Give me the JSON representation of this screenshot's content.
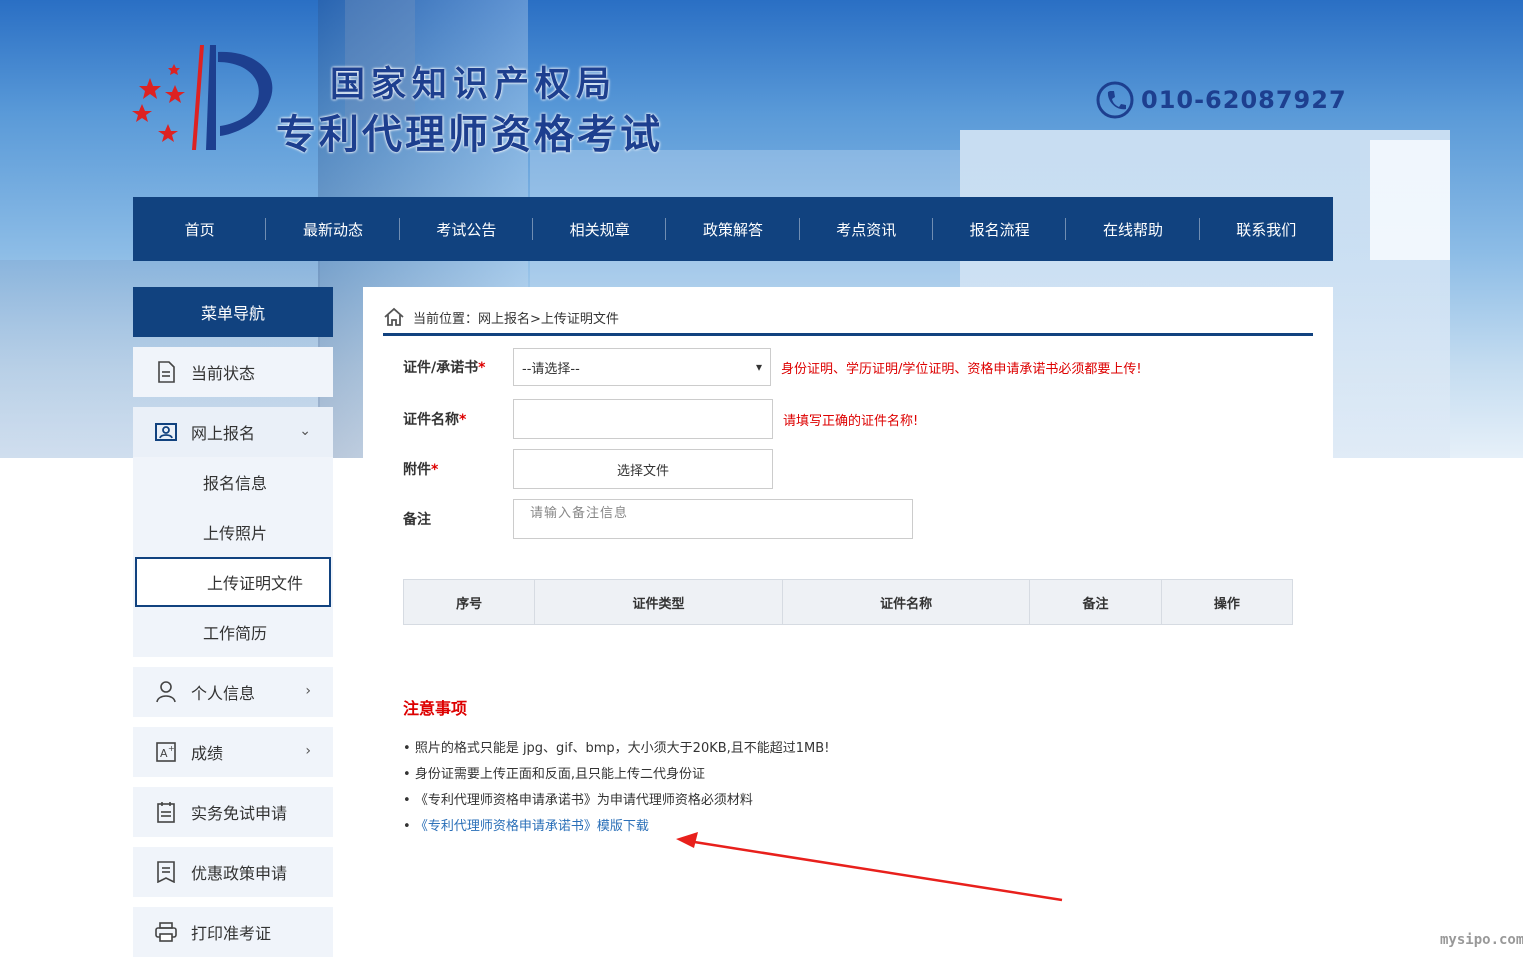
{
  "header": {
    "title_line1": "国家知识产权局",
    "title_line2": "专利代理师资格考试",
    "phone": "010-62087927"
  },
  "nav": [
    "首页",
    "最新动态",
    "考试公告",
    "相关规章",
    "政策解答",
    "考点资讯",
    "报名流程",
    "在线帮助",
    "联系我们"
  ],
  "sidebar": {
    "head": "菜单导航",
    "status": "当前状态",
    "signup": "网上报名",
    "signup_sub": [
      "报名信息",
      "上传照片",
      "上传证明文件",
      "工作简历"
    ],
    "personal": "个人信息",
    "score": "成绩",
    "exempt": "实务免试申请",
    "policy": "优惠政策申请",
    "print": "打印准考证"
  },
  "breadcrumb": "当前位置：网上报名>上传证明文件",
  "form": {
    "doc_type_label": "证件/承诺书",
    "doc_type_value": "--请选择--",
    "doc_type_hint": "身份证明、学历证明/学位证明、资格申请承诺书必须都要上传!",
    "doc_name_label": "证件名称",
    "doc_name_hint": "请填写正确的证件名称!",
    "attach_label": "附件",
    "attach_button": "选择文件",
    "remark_label": "备注",
    "remark_placeholder": "请输入备注信息",
    "required_mark": "*"
  },
  "table": {
    "columns": [
      "序号",
      "证件类型",
      "证件名称",
      "备注",
      "操作"
    ]
  },
  "notice": {
    "title": "注意事项",
    "items": [
      "照片的格式只能是 jpg、gif、bmp，大小须大于20KB,且不能超过1MB!",
      "身份证需要上传正面和反面,且只能上传二代身份证",
      "《专利代理师资格申请承诺书》为申请代理师资格必须材料",
      "《专利代理师资格申请承诺书》模版下载"
    ]
  },
  "watermark": "mysipo.com"
}
